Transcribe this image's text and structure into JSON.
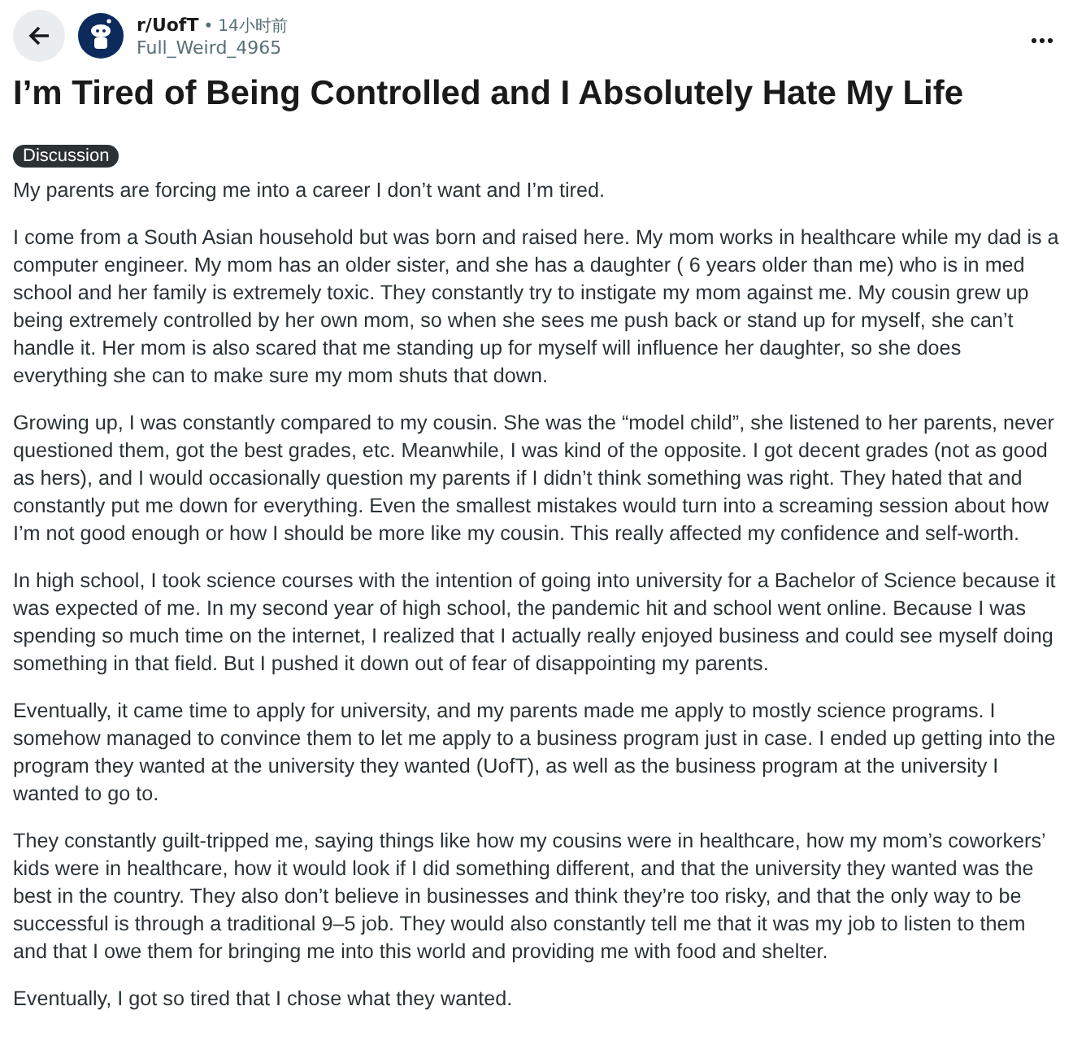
{
  "post": {
    "subreddit": "r/UofT",
    "separator": "•",
    "time": "14小时前",
    "author": "Full_Weird_4965",
    "title": "I’m Tired of Being Controlled and I Absolutely Hate My Life",
    "flair": "Discussion",
    "paragraphs": [
      "My parents are forcing me into a career I don’t want and I’m tired.",
      "I come from a South Asian household but was born and raised here. My mom works in healthcare while my dad is a computer engineer. My mom has an older sister, and she has a daughter ( 6 years older than me) who is in med school and her family is extremely toxic. They constantly try to instigate my mom against me. My cousin grew up being extremely controlled by her own mom, so when she sees me push back or stand up for myself, she can’t handle it. Her mom is also scared that me standing up for myself will influence her daughter, so she does everything she can to make sure my mom shuts that down.",
      "Growing up, I was constantly compared to my cousin. She was the “model child”, she listened to her parents, never questioned them, got the best grades, etc. Meanwhile, I was kind of the opposite. I got decent grades (not as good as hers), and I would occasionally question my parents if I didn’t think something was right. They hated that and constantly put me down for everything. Even the smallest mistakes would turn into a screaming session about how I’m not good enough or how I should be more like my cousin. This really affected my confidence and self-worth.",
      "In high school, I took science courses with the intention of going into university for a Bachelor of Science because it was expected of me. In my second year of high school, the pandemic hit and school went online. Because I was spending so much time on the internet, I realized that I actually really enjoyed business and could see myself doing something in that field. But I pushed it down out of fear of disappointing my parents.",
      "Eventually, it came time to apply for university, and my parents made me apply to mostly science programs. I somehow managed to convince them to let me apply to a business program just in case. I ended up getting into the program they wanted at the university they wanted (UofT), as well as the business program at the university I wanted to go to.",
      "They constantly guilt-tripped me, saying things like how my cousins were in healthcare, how my mom’s coworkers’ kids were in healthcare, how it would look if I did something different, and that the university they wanted was the best in the country. They also don’t believe in businesses and think they’re too risky, and that the only way to be successful is through a traditional 9–5 job. They would also constantly tell me that it was my job to listen to them and that I owe them for bringing me into this world and providing me with food and shelter.",
      "Eventually, I got so tired that I chose what they wanted."
    ]
  }
}
